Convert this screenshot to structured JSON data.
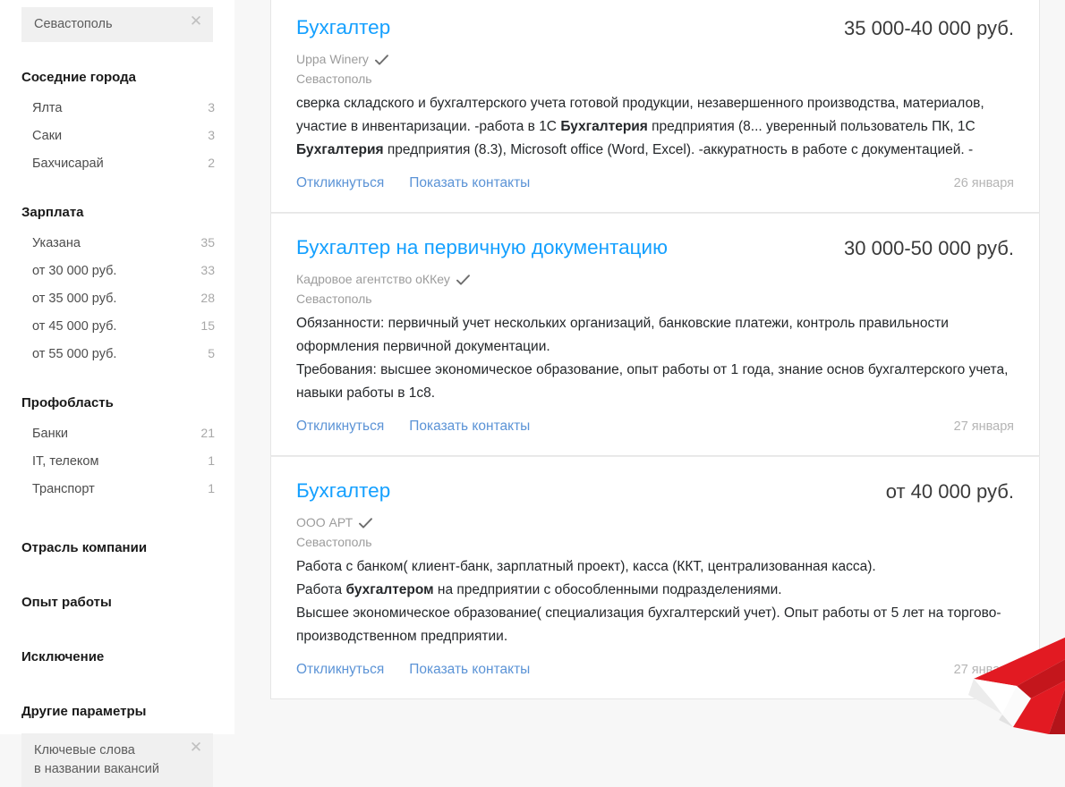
{
  "sidebar": {
    "location_chip": {
      "label": "Севастополь",
      "close_icon": "close-icon"
    },
    "sections": [
      {
        "title": "Соседние города",
        "items": [
          {
            "label": "Ялта",
            "count": "3"
          },
          {
            "label": "Саки",
            "count": "3"
          },
          {
            "label": "Бахчисарай",
            "count": "2"
          }
        ]
      },
      {
        "title": "Зарплата",
        "items": [
          {
            "label": "Указана",
            "count": "35"
          },
          {
            "label": "от 30 000 руб.",
            "count": "33"
          },
          {
            "label": "от 35 000 руб.",
            "count": "28"
          },
          {
            "label": "от 45 000 руб.",
            "count": "15"
          },
          {
            "label": "от 55 000 руб.",
            "count": "5"
          }
        ]
      },
      {
        "title": "Профобласть",
        "items": [
          {
            "label": "Банки",
            "count": "21"
          },
          {
            "label": "IT, телеком",
            "count": "1"
          },
          {
            "label": "Транспорт",
            "count": "1"
          }
        ]
      }
    ],
    "plain_sections": [
      {
        "title": "Отрасль компании"
      },
      {
        "title": "Опыт работы"
      },
      {
        "title": "Исключение"
      },
      {
        "title": "Другие параметры"
      }
    ],
    "keyword_chip": {
      "line1": "Ключевые слова",
      "line2": "в названии вакансий",
      "close_icon": "close-icon"
    }
  },
  "results": {
    "labels": {
      "apply": "Откликнуться",
      "show_contacts": "Показать контакты"
    },
    "cards": [
      {
        "title": "Бухгалтер",
        "salary": "35 000-40 000 руб.",
        "company": "Uppa Winery",
        "verified": true,
        "region": "Севастополь",
        "description_html": "сверка складского и бухгалтерского учета готовой продукции, незавершенного производства, материалов, участие в инвентаризации. -работа в 1С <b>Бухгалтерия</b> предприятия (8... уверенный пользователь ПК, 1С <b>Бухгалтерия</b> предприятия (8.3), Microsoft office (Word, Excel). -аккуратность в работе с документацией. -",
        "date": "26 января"
      },
      {
        "title": "Бухгалтер на первичную документацию",
        "salary": "30 000-50 000 руб.",
        "company": "Кадровое агентство оККеу",
        "verified": true,
        "region": "Севастополь",
        "description_html": "Обязанности: первичный учет нескольких организаций, банковские платежи, контроль правильности оформления первичной документации.<br>Требования: высшее экономическое образование, опыт работы от 1 года, знание основ бухгалтерского учета, навыки работы в 1с8.",
        "date": "27 января"
      },
      {
        "title": "Бухгалтер",
        "salary": "от 40 000 руб.",
        "company": "ООО АРТ",
        "verified": true,
        "region": "Севастополь",
        "description_html": "Работа с банком( клиент-банк, зарплатный проект), касса (ККТ, централизованная касса).<br>Работа <b>бухгалтером</b> на предприятии с обособленными подразделениями.<br>Высшее экономическое образование( специализация бухгалтерский учет). Опыт работы от 5 лет на торгово-производственном предприятии.",
        "date": "27 января"
      }
    ]
  },
  "decoration": {
    "paper_plane_icon": "paper-plane-icon",
    "colors": {
      "plane_red": "#e21a22",
      "plane_red_dark": "#b3141a",
      "plane_white": "#ffffff",
      "plane_shade": "#e0e0e0"
    }
  },
  "theme": {
    "title_link": "#14a0ff",
    "action_link": "#5b93d6",
    "page_bg": "#f7f7f7",
    "card_bg": "#ffffff",
    "muted_text": "#9c9c9c"
  }
}
